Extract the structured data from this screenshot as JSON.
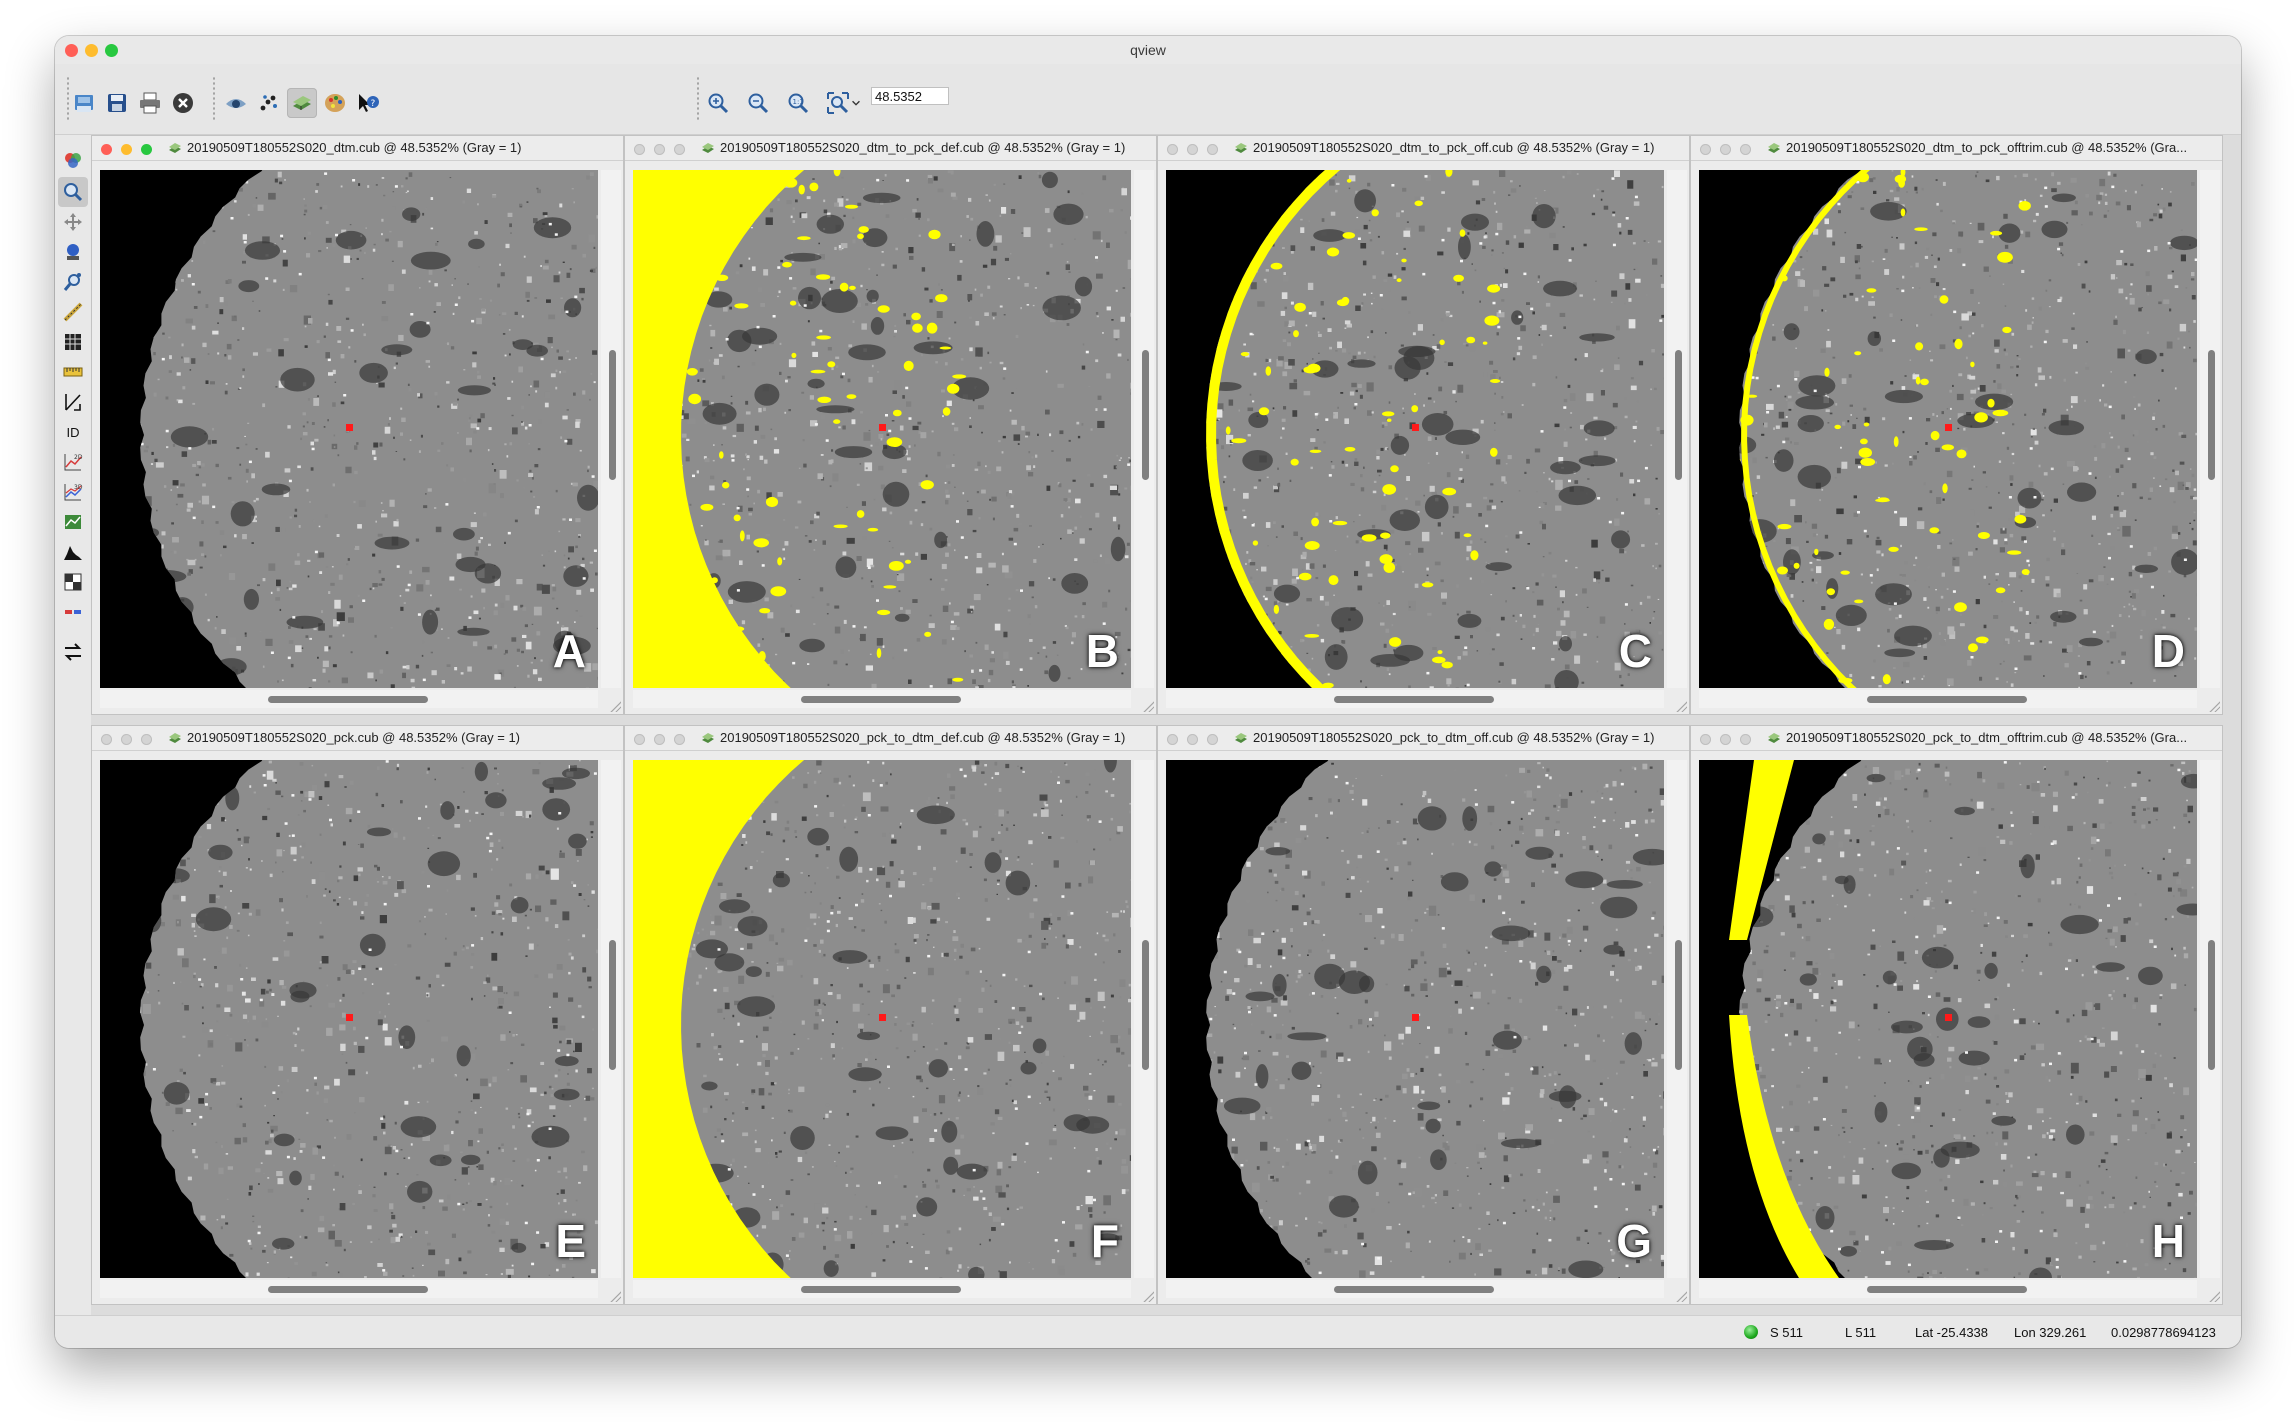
{
  "window": {
    "title": "qview",
    "traffic_colors": [
      "#ff5f57",
      "#febc2e",
      "#28c840"
    ]
  },
  "toolbar": {
    "file_buttons": [
      "open-file-icon",
      "save-icon",
      "print-icon",
      "close-all-icon"
    ],
    "view_buttons": [
      "blink-icon",
      "scatter-icon",
      "link-viewports-icon",
      "palette-icon",
      "whats-this-icon"
    ],
    "zoom_buttons": [
      "zoom-in-icon",
      "zoom-out-icon",
      "zoom-actual-icon",
      "zoom-fit-icon"
    ],
    "zoom_value": "48.5352"
  },
  "left_tools": [
    {
      "name": "band-tool-icon"
    },
    {
      "name": "zoom-tool-icon",
      "active": true
    },
    {
      "name": "pan-tool-icon"
    },
    {
      "name": "stretch-tool-icon"
    },
    {
      "name": "find-tool-icon"
    },
    {
      "name": "measure-tool-icon"
    },
    {
      "name": "stats-tool-icon"
    },
    {
      "name": "ruler-tool-icon"
    },
    {
      "name": "special-pixel-tool-icon"
    },
    {
      "name": "feature-id-tool",
      "text": "ID"
    },
    {
      "name": "plot-2d-tool-icon",
      "text": "2D"
    },
    {
      "name": "plot-3d-tool-icon",
      "text": "3D"
    },
    {
      "name": "spectral-tool-icon"
    },
    {
      "name": "histogram-tool-icon"
    },
    {
      "name": "edit-tool-icon"
    },
    {
      "name": "stereo-tool-icon"
    },
    {
      "name": "swap-tool-icon"
    }
  ],
  "viewports": [
    {
      "caption": "20190509T180552S020_dtm.cub @ 48.5352% (Gray = 1)",
      "letter": "A",
      "fill": "none",
      "active": true
    },
    {
      "caption": "20190509T180552S020_dtm_to_pck_def.cub @ 48.5352% (Gray = 1)",
      "letter": "B",
      "fill": "yellow-left"
    },
    {
      "caption": "20190509T180552S020_dtm_to_pck_off.cub @ 48.5352% (Gray = 1)",
      "letter": "C",
      "fill": "yellow-rim"
    },
    {
      "caption": "20190509T180552S020_dtm_to_pck_offtrim.cub @ 48.5352% (Gra...",
      "letter": "D",
      "fill": "yellow-rim-thin"
    },
    {
      "caption": "20190509T180552S020_pck.cub @ 48.5352% (Gray = 1)",
      "letter": "E",
      "fill": "none"
    },
    {
      "caption": "20190509T180552S020_pck_to_dtm_def.cub @ 48.5352% (Gray = 1)",
      "letter": "F",
      "fill": "yellow-left-full"
    },
    {
      "caption": "20190509T180552S020_pck_to_dtm_off.cub @ 48.5352% (Gray = 1)",
      "letter": "G",
      "fill": "none"
    },
    {
      "caption": "20190509T180552S020_pck_to_dtm_offtrim.cub @ 48.5352% (Gra...",
      "letter": "H",
      "fill": "yellow-band"
    }
  ],
  "colors": {
    "fill": "#ffff00",
    "marker": "#ff1a1a",
    "background": "#000000"
  },
  "status": {
    "sample": "S 511",
    "line": "L 511",
    "lat": "Lat -25.4338",
    "lon": "Lon 329.261",
    "value": "0.0298778694123"
  }
}
